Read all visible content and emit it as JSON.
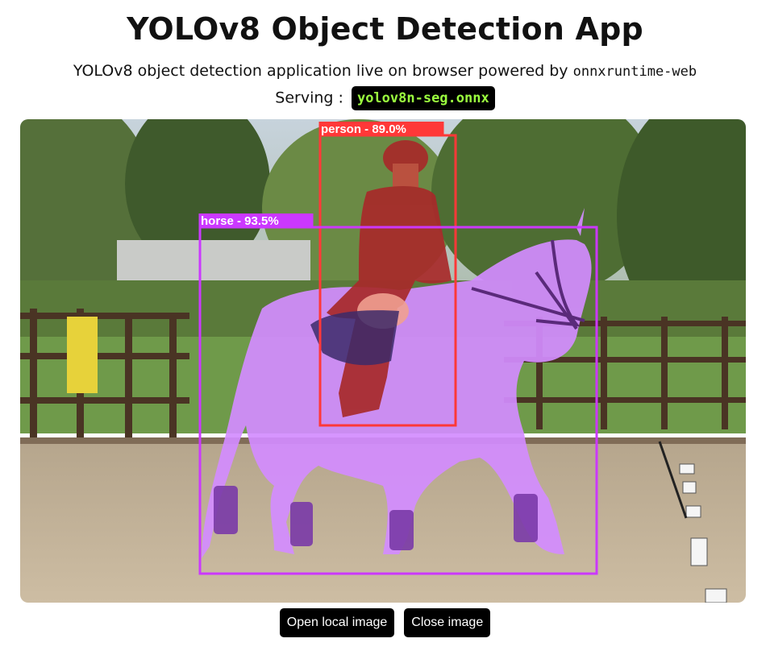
{
  "app": {
    "title": "YOLOv8 Object Detection App",
    "subtitle_prefix": "YOLOv8 object detection application live on browser powered by",
    "subtitle_code": "onnxruntime-web",
    "serving_label": "Serving :",
    "model_name": "yolov8n-seg.onnx"
  },
  "detections": [
    {
      "label": "person - 89.0%",
      "class": "person",
      "confidence": 89.0,
      "color": "#ff3838"
    },
    {
      "label": "horse - 93.5%",
      "class": "horse",
      "confidence": 93.5,
      "color": "#cb38ff"
    }
  ],
  "buttons": {
    "open_label": "Open local image",
    "close_label": "Close image"
  },
  "colors": {
    "badge_bg": "#000000",
    "badge_text": "#9bff3f",
    "button_bg": "#000000",
    "button_text": "#ffffff"
  }
}
